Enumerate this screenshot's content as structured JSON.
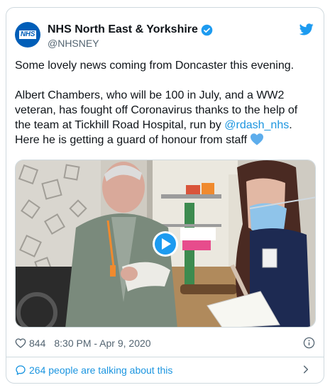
{
  "account": {
    "display_name": "NHS North East & Yorkshire",
    "handle": "@NHSNEY",
    "avatar_text": "NHS"
  },
  "tweet": {
    "line1": "Some lovely news coming from Doncaster this evening.",
    "line2": "Albert Chambers, who will be 100 in July, and a WW2 veteran, has fought off Coronavirus thanks to the help of the team at Tickhill Road Hospital, run by ",
    "mention": "@rdash_nhs",
    "line3": ". Here he is getting a guard of honour from staff "
  },
  "stats": {
    "likes": "844",
    "timestamp": "8:30 PM - Apr 9, 2020"
  },
  "footer": {
    "talking_text": "264 people are talking about this"
  },
  "colors": {
    "accent": "#1b95e0",
    "nhs_blue": "#005eb8",
    "text": "#0f1419",
    "muted": "#536471",
    "border": "#cfd9de"
  }
}
